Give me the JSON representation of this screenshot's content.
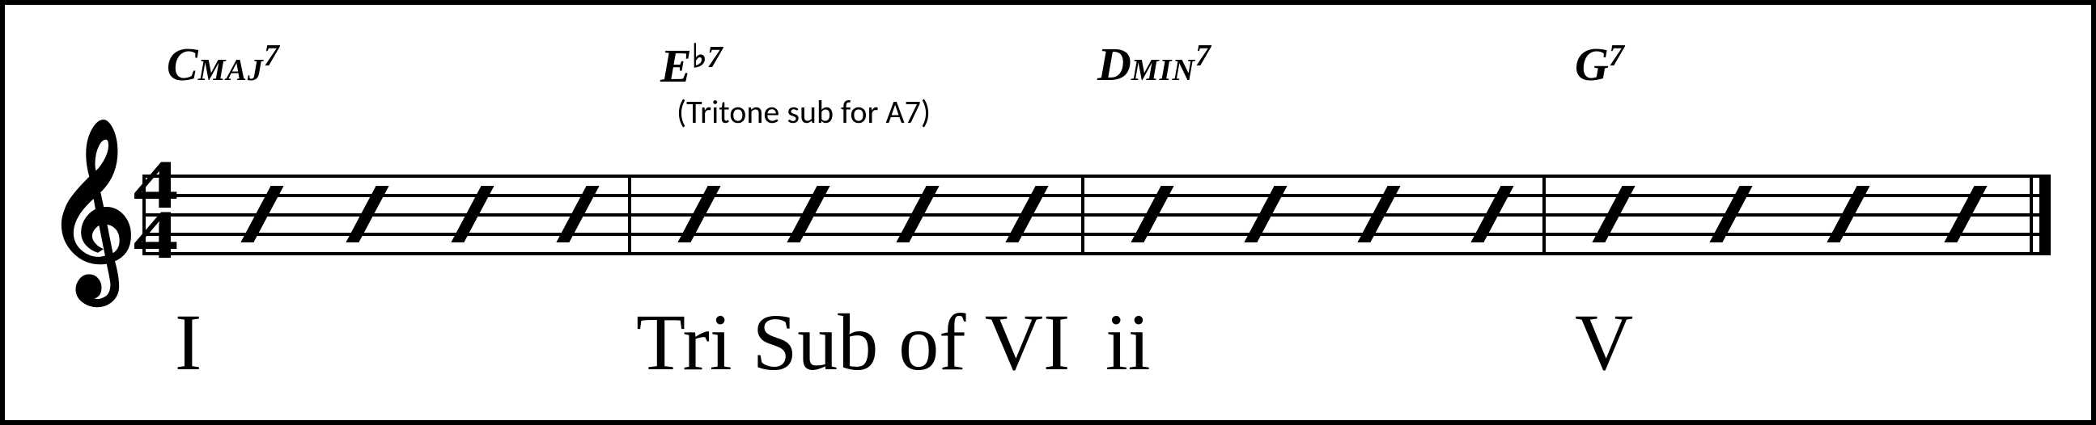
{
  "timesig": {
    "top": "4",
    "bottom": "4"
  },
  "measures": [
    {
      "chord": {
        "root": "C",
        "quality": "MAJ",
        "alteration": "7",
        "flat_before_alt": false
      },
      "subnote": "",
      "roman": "I",
      "slashes": 4
    },
    {
      "chord": {
        "root": "E",
        "quality": "",
        "alteration": "7",
        "flat_before_alt": true
      },
      "subnote": "(Tritone sub for A7)",
      "roman": "Tri Sub of VI",
      "slashes": 4
    },
    {
      "chord": {
        "root": "D",
        "quality": "MIN",
        "alteration": "7",
        "flat_before_alt": false
      },
      "subnote": "",
      "roman": "ii",
      "slashes": 4
    },
    {
      "chord": {
        "root": "G",
        "quality": "",
        "alteration": "7",
        "flat_before_alt": false
      },
      "subnote": "",
      "roman": "V",
      "slashes": 4
    }
  ]
}
